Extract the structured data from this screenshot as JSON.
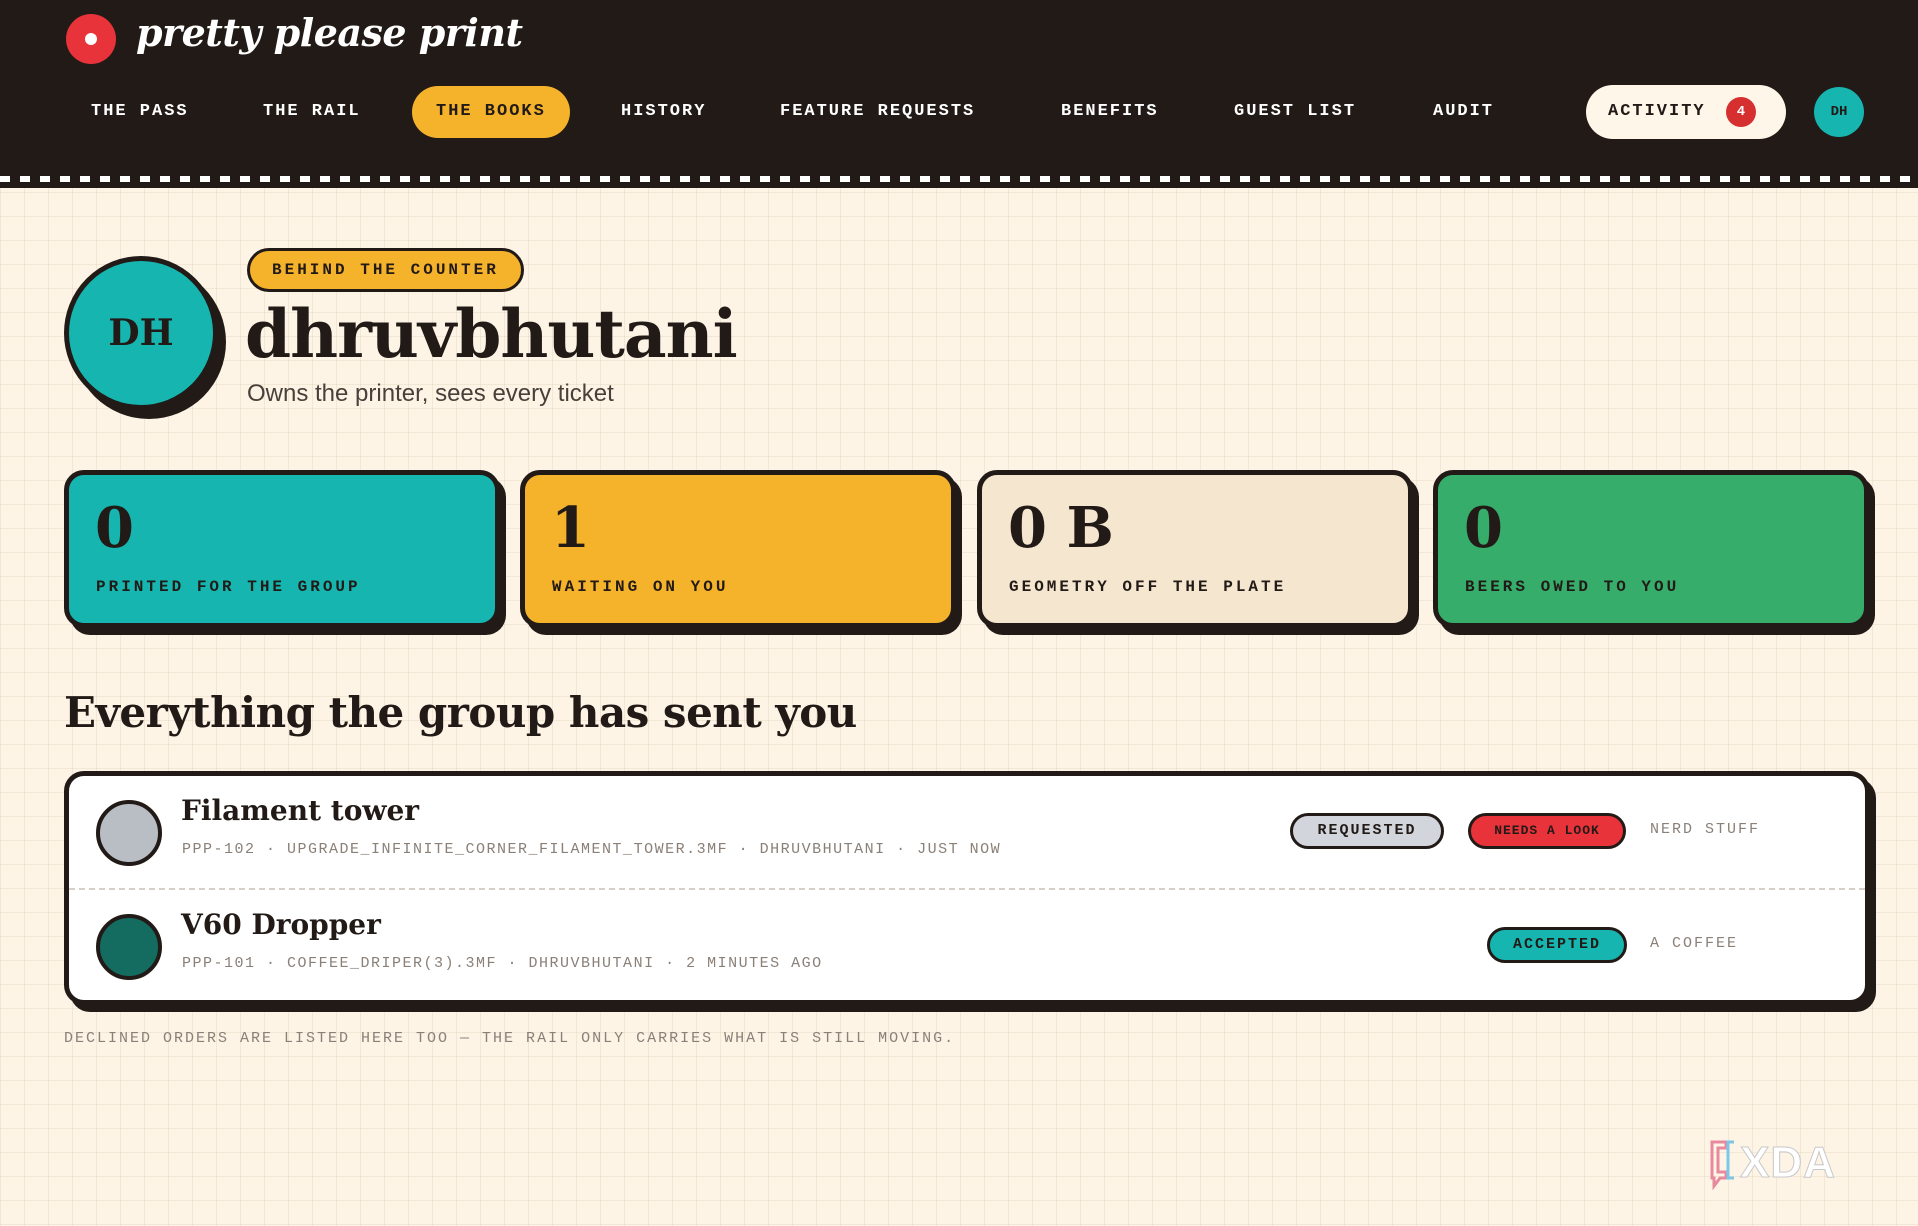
{
  "app": {
    "brand": "pretty please print"
  },
  "nav": {
    "items": [
      {
        "label": "THE PASS"
      },
      {
        "label": "THE RAIL"
      },
      {
        "label": "THE BOOKS",
        "active": true
      },
      {
        "label": "HISTORY"
      },
      {
        "label": "FEATURE REQUESTS"
      },
      {
        "label": "BENEFITS"
      },
      {
        "label": "GUEST LIST"
      },
      {
        "label": "AUDIT"
      }
    ],
    "activity": {
      "label": "ACTIVITY",
      "count": "4"
    },
    "user_initials": "DH"
  },
  "profile": {
    "initials": "DH",
    "role_badge": "BEHIND THE COUNTER",
    "username": "dhruvbhutani",
    "tagline": "Owns the printer, sees every ticket"
  },
  "stats": [
    {
      "value": "0",
      "label": "PRINTED FOR THE GROUP",
      "color": "#16b5b0"
    },
    {
      "value": "1",
      "label": "WAITING ON YOU",
      "color": "#f5b32b"
    },
    {
      "value": "0 B",
      "label": "GEOMETRY OFF THE PLATE",
      "color": "#f5e6cf"
    },
    {
      "value": "0",
      "label": "BEERS OWED TO YOU",
      "color": "#36ad6b"
    }
  ],
  "section_title": "Everything the group has sent you",
  "orders": [
    {
      "title": "Filament tower",
      "meta": "PPP-102 · UPGRADE_INFINITE_CORNER_FILAMENT_TOWER.3MF · DHRUVBHUTANI · JUST NOW",
      "thumb_color": "#b9bec4",
      "status": {
        "label": "REQUESTED",
        "color": "#d2d6dc"
      },
      "flag": {
        "label": "NEEDS A LOOK",
        "color": "#e8333b"
      },
      "tag": "NERD STUFF"
    },
    {
      "title": "V60 Dropper",
      "meta": "PPP-101 · COFFEE_DRIPER(3).3MF · DHRUVBHUTANI · 2 MINUTES AGO",
      "thumb_color": "#146b60",
      "status": {
        "label": "ACCEPTED",
        "color": "#16b5b0"
      },
      "tag": "A COFFEE"
    }
  ],
  "footnote": "DECLINED ORDERS ARE LISTED HERE TOO — THE RAIL ONLY CARRIES WHAT IS STILL MOVING.",
  "watermark": "XDA"
}
